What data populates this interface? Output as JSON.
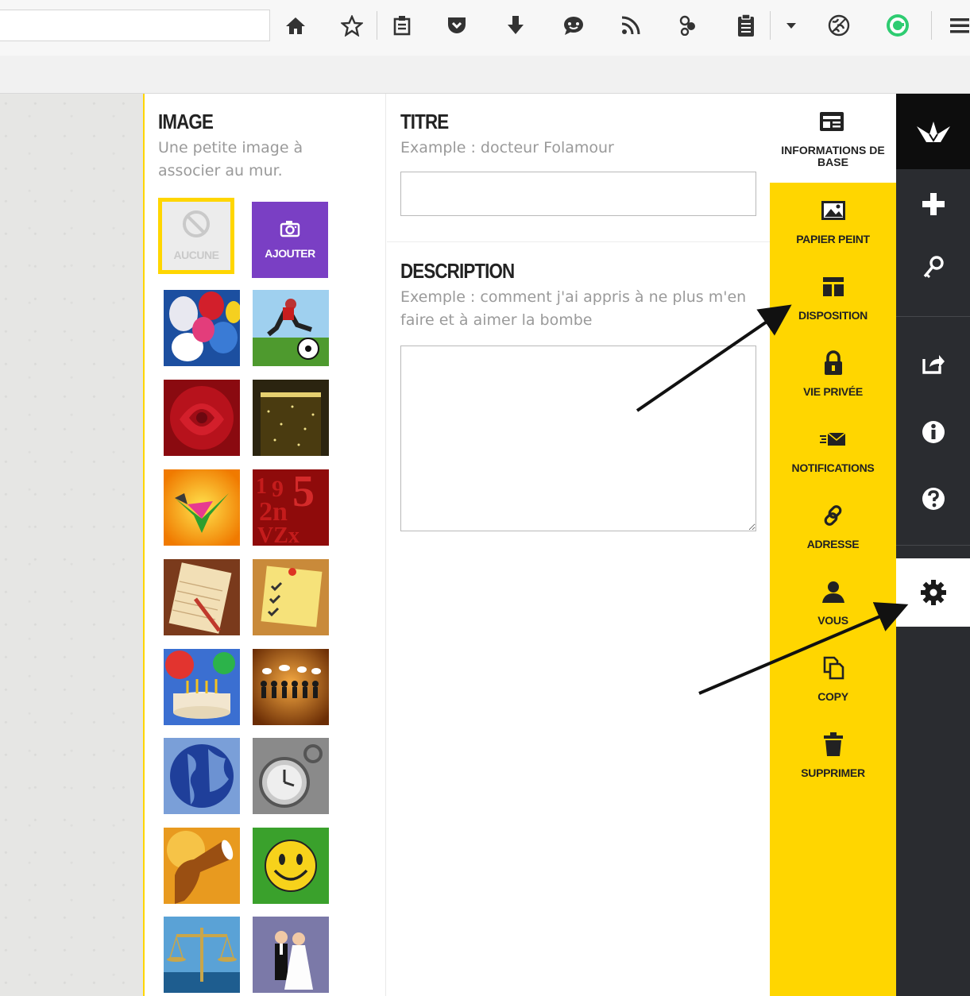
{
  "browser_toolbar": {
    "icons": [
      "home-icon",
      "bookmark-star-icon",
      "reader-icon",
      "pocket-icon",
      "download-icon",
      "chat-icon",
      "rss-icon",
      "extension-icon",
      "clipboard-icon",
      "menu-dropdown-icon",
      "globe-icon",
      "green-circle-icon",
      "hamburger-menu-icon"
    ]
  },
  "image_section": {
    "title": "IMAGE",
    "hint": "Une petite image à associer au mur.",
    "none_label": "AUCUNE",
    "add_label": "AJOUTER",
    "thumbnails": [
      "balloons",
      "soccer-player",
      "red-rose",
      "champagne",
      "origami-crane",
      "red-numbers",
      "notebook-pencil",
      "sticky-note-checklist",
      "birthday-cake",
      "crowd-speech-bubbles",
      "globe",
      "pocket-watch",
      "megaphone",
      "smiley-face",
      "scales-of-justice",
      "wedding-couple"
    ]
  },
  "form": {
    "title_label": "TITRE",
    "title_hint": "Example : docteur Folamour",
    "title_value": "",
    "description_label": "DESCRIPTION",
    "description_hint": "Exemple : comment j'ai appris à ne plus m'en faire et à aimer la bombe",
    "description_value": ""
  },
  "menu": {
    "items": [
      {
        "label": "INFORMATIONS DE BASE",
        "icon": "info-card-icon"
      },
      {
        "label": "PAPIER PEINT",
        "icon": "picture-icon"
      },
      {
        "label": "DISPOSITION",
        "icon": "layout-icon"
      },
      {
        "label": "VIE PRIVÉE",
        "icon": "lock-icon"
      },
      {
        "label": "NOTIFICATIONS",
        "icon": "envelope-icon"
      },
      {
        "label": "ADRESSE",
        "icon": "link-icon"
      },
      {
        "label": "VOUS",
        "icon": "person-icon"
      },
      {
        "label": "COPY",
        "icon": "copy-icon"
      },
      {
        "label": "SUPPRIMER",
        "icon": "trash-icon"
      }
    ],
    "accent_color": "#ffd600"
  },
  "sidebar": {
    "buttons": [
      "padlet-logo-icon",
      "plus-icon",
      "key-icon",
      "share-icon",
      "info-icon",
      "help-icon",
      "gear-icon"
    ],
    "background_color": "#2a2c30"
  }
}
